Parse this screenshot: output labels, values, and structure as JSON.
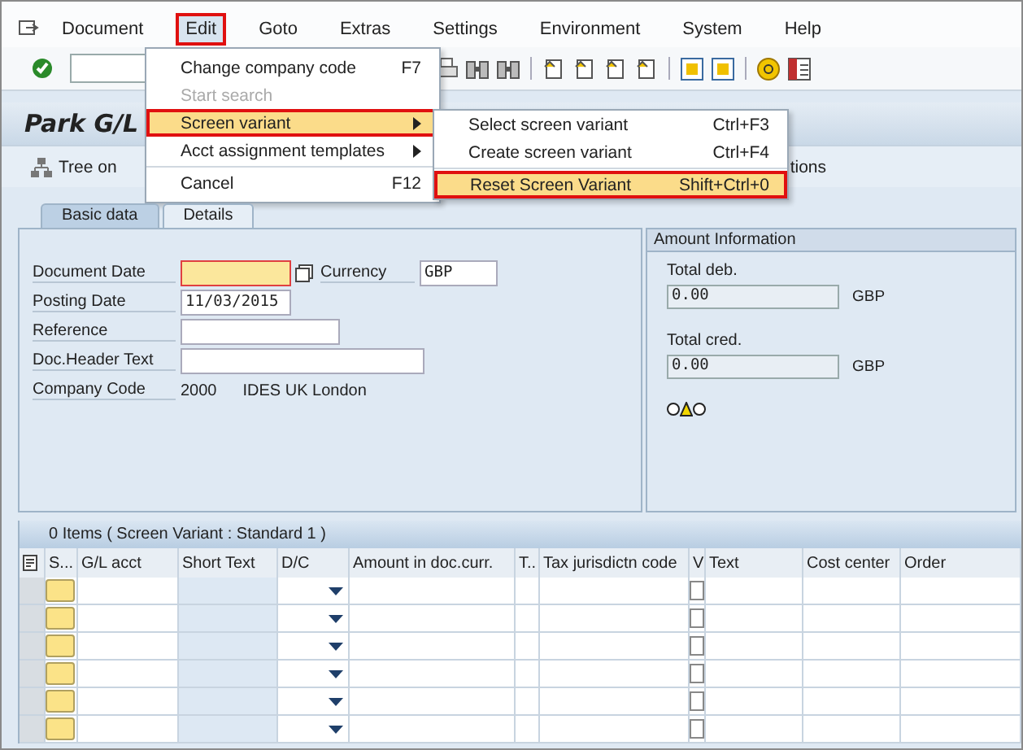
{
  "menu_bar": [
    {
      "label": "Document",
      "selected": false,
      "marked": false
    },
    {
      "label": "Edit",
      "selected": true,
      "marked": true
    },
    {
      "label": "Goto",
      "selected": false,
      "marked": false
    },
    {
      "label": "Extras",
      "selected": false,
      "marked": false
    },
    {
      "label": "Settings",
      "selected": false,
      "marked": false
    },
    {
      "label": "Environment",
      "selected": false,
      "marked": false
    },
    {
      "label": "System",
      "selected": false,
      "marked": false
    },
    {
      "label": "Help",
      "selected": false,
      "marked": false
    }
  ],
  "edit_menu": [
    {
      "label": "Change company code",
      "shortcut": "F7",
      "disabled": false,
      "submenu": false,
      "selected": false,
      "marked": false
    },
    {
      "label": "Start search",
      "disabled": true,
      "submenu": false,
      "selected": false,
      "marked": false
    },
    {
      "label": "Screen variant",
      "disabled": false,
      "submenu": true,
      "selected": true,
      "marked": true
    },
    {
      "label": "Acct assignment templates",
      "disabled": false,
      "submenu": true,
      "selected": false,
      "marked": false
    },
    {
      "label": "Cancel",
      "shortcut": "F12",
      "disabled": false,
      "submenu": false,
      "selected": false,
      "marked": false
    }
  ],
  "screen_variant_menu": [
    {
      "label": "Select screen variant",
      "shortcut": "Ctrl+F3",
      "selected": false,
      "marked": false
    },
    {
      "label": "Create screen variant",
      "shortcut": "Ctrl+F4",
      "selected": false,
      "marked": false
    },
    {
      "label": "Reset Screen Variant",
      "shortcut": "Shift+Ctrl+0",
      "selected": true,
      "marked": true
    }
  ],
  "title": "Park G/L",
  "app_toolbar": {
    "tree_button": "Tree on",
    "cut_button": "tions"
  },
  "tabs": [
    {
      "label": "Basic data",
      "selected": true
    },
    {
      "label": "Details",
      "selected": false
    }
  ],
  "form": [
    {
      "label": "Document Date",
      "kind": "input",
      "highlighted": true,
      "picker": true,
      "side": {
        "label": "Currency",
        "value": "GBP"
      }
    },
    {
      "label": "Posting Date",
      "kind": "input",
      "value": "11/03/2015",
      "highlighted": false,
      "picker": false
    },
    {
      "label": "Reference",
      "kind": "input",
      "highlighted": false,
      "picker": false
    },
    {
      "label": "Doc.Header Text",
      "kind": "input",
      "highlighted": false,
      "picker": false
    },
    {
      "label": "Company Code",
      "kind": "text",
      "value": "2000",
      "extra": "IDES UK London"
    }
  ],
  "amount_info": {
    "title": "Amount Information",
    "totals": [
      {
        "label": "Total deb.",
        "value": "0.00",
        "currency": "GBP"
      },
      {
        "label": "Total cred.",
        "value": "0.00",
        "currency": "GBP"
      }
    ],
    "lights": [
      {
        "on": false
      },
      {
        "on": true
      },
      {
        "on": false
      }
    ]
  },
  "table": {
    "caption": "0 Items ( Screen Variant : Standard 1 )",
    "columns": [
      "S...",
      "G/L acct",
      "Short Text",
      "D/C",
      "Amount in doc.curr.",
      "T..",
      "Tax jurisdictn code",
      "V",
      "Text",
      "Cost center",
      "Order"
    ],
    "rows": [
      {
        "checked": false
      },
      {
        "checked": false
      },
      {
        "checked": false
      },
      {
        "checked": false
      },
      {
        "checked": false
      },
      {
        "checked": false
      }
    ]
  }
}
